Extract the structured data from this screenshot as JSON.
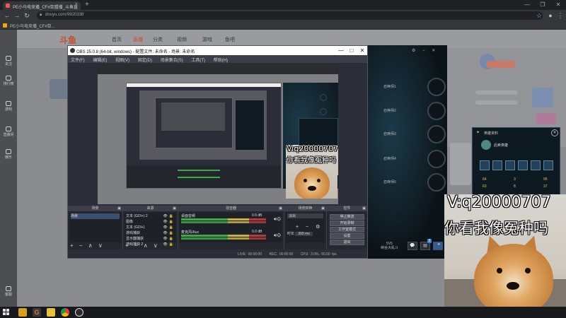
{
  "browser": {
    "tab_title": "PE小马电竞播_CF#亚盟播_斗鱼直",
    "tab_close": "×",
    "new_tab": "+",
    "window_controls": [
      "—",
      "❐",
      "✕"
    ],
    "nav": {
      "back": "←",
      "forward": "→",
      "reload": "↻"
    },
    "url": "douyu.com/9920338",
    "bookmark": "PE小马电竞播_CF#亚...",
    "toolbar_icons": [
      "☆",
      "●",
      "⋮"
    ]
  },
  "douyu": {
    "logo": "斗鱼",
    "nav": [
      "首页",
      "直播",
      "分类",
      "视频",
      "游戏",
      "鱼吧"
    ],
    "sidebar": [
      "关注",
      "排行榜",
      "游戏",
      "直播间",
      "娱乐",
      "客服"
    ]
  },
  "obs": {
    "title": "OBS 25.0.8 (64-bit, windows) - 配置文件: 未命名 - 场景: 未命名",
    "window_controls": [
      "—",
      "□",
      "✕"
    ],
    "menu": [
      "文件(F)",
      "编辑(E)",
      "视图(V)",
      "固定(D)",
      "场景集合(S)",
      "工具(T)",
      "帮助(H)"
    ],
    "docks": {
      "scenes": {
        "title": "场景",
        "items": [
          "场景"
        ]
      },
      "sources": {
        "title": "来源",
        "items": [
          "文本 (GDI+) 2",
          "图像",
          "文本 (GDI+)",
          "游戏捕获",
          "显示器捕获",
          "游戏捕获 2"
        ]
      },
      "mixer": {
        "title": "混音器",
        "channels": [
          {
            "name": "桌面音频",
            "level": "0.0 dB"
          },
          {
            "name": "麦克风/Aux",
            "level": "0.0 dB"
          }
        ]
      },
      "transitions": {
        "title": "场景转换",
        "select": "淡出",
        "duration_label": "时长",
        "duration": "300 ms"
      },
      "controls": {
        "title": "控件",
        "buttons": [
          "停止推流",
          "开始录制",
          "工作室模式",
          "设置",
          "退出"
        ]
      }
    },
    "status": [
      "LIVE: 00:00:00",
      "REC: 00:00:00",
      "CPU: 3.0%, 60.00 fps"
    ],
    "dock_footer": "+ − ∧ ∨"
  },
  "game": {
    "summoner_label": "召唤师",
    "summoners": [
      "召唤师1",
      "召唤师2",
      "召唤师3",
      "召唤师4",
      "召唤师5"
    ],
    "mode_line1": "5V5",
    "mode_line2": "峡谷大乱斗",
    "badge": "2",
    "buttons": [
      "💬",
      "▤",
      "🎤"
    ],
    "hero_card": {
      "title": "英雄资料",
      "close": "✕",
      "name": "后卖英雄",
      "stats": [
        "64",
        "3",
        "95",
        "63",
        "8",
        "37"
      ]
    }
  },
  "meme": {
    "line1": "V:q20000707",
    "line2": "你看我像冤种吗"
  }
}
